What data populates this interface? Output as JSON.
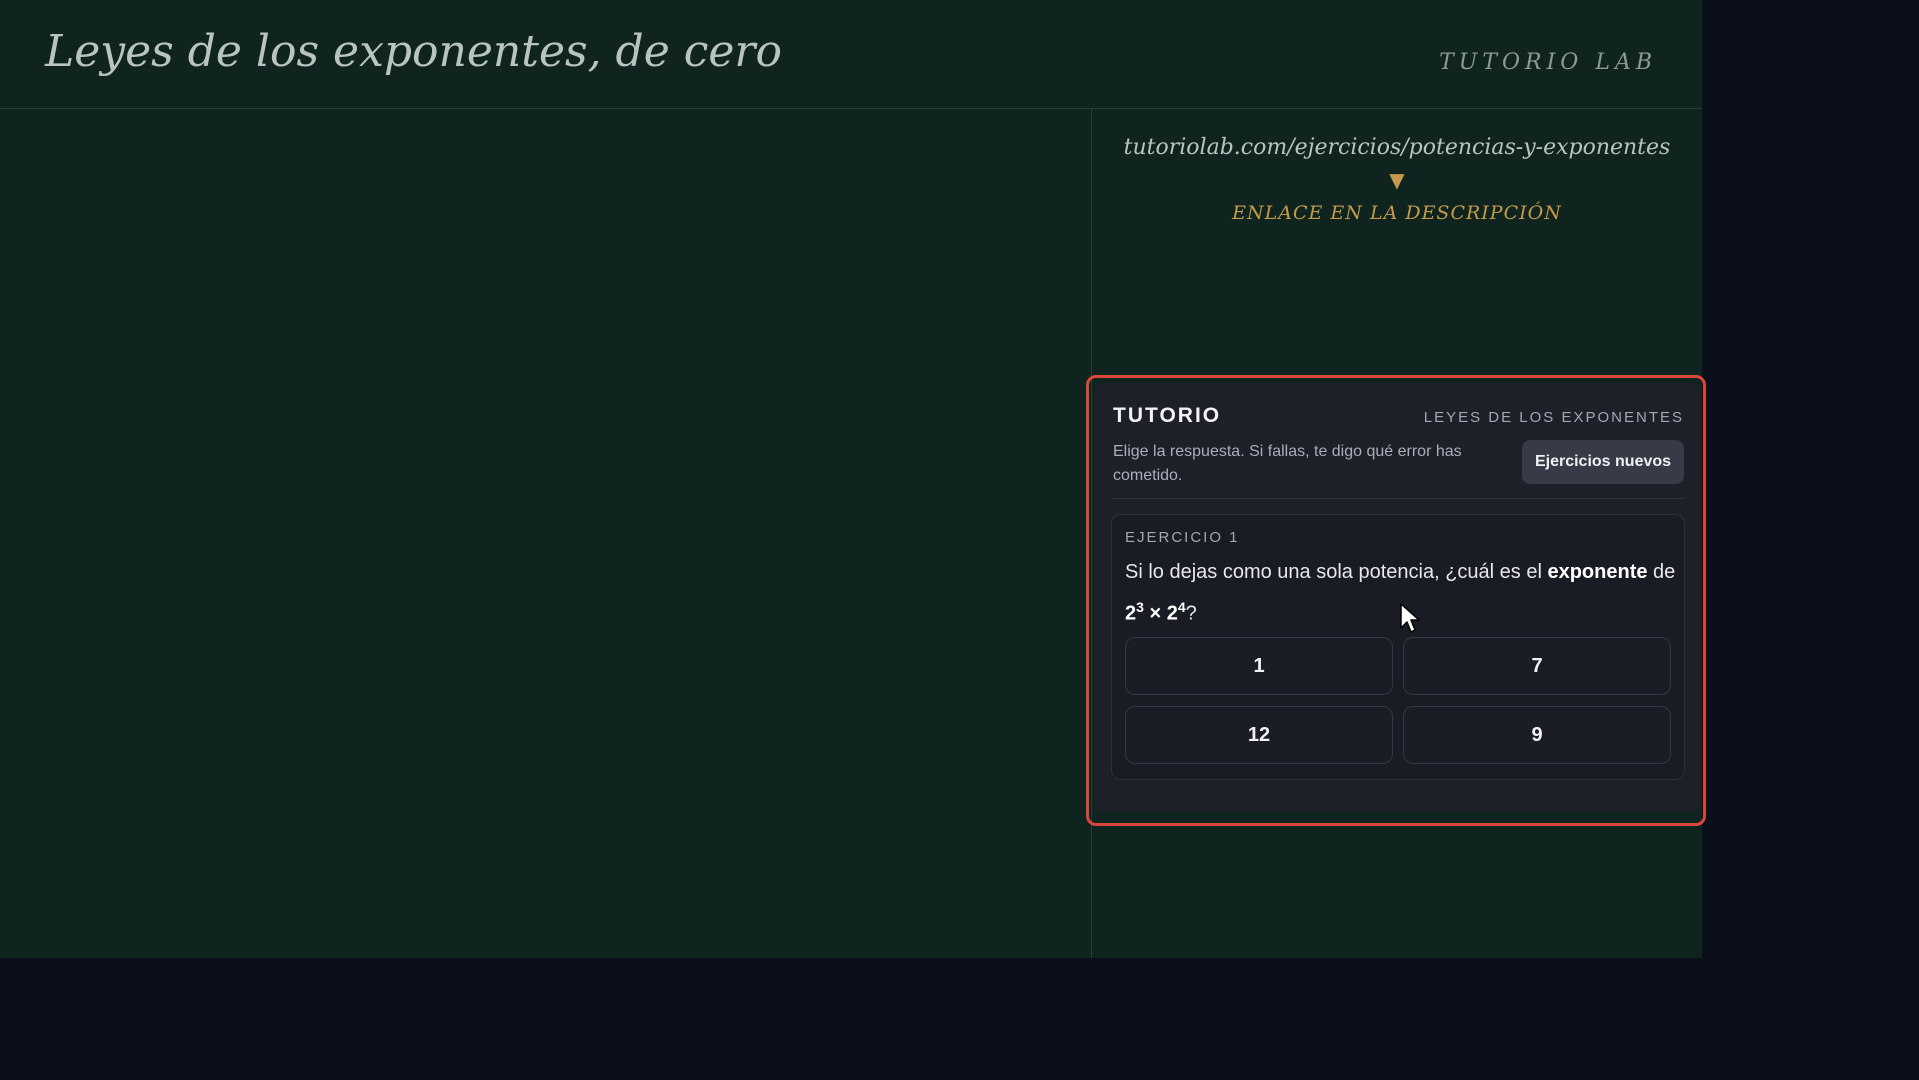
{
  "header": {
    "title": "Leyes de los exponentes, de cero",
    "brand": "TUTORIO LAB"
  },
  "link_area": {
    "url": "tutoriolab.com/ejercicios/potencias-y-exponentes",
    "arrow": "▼",
    "note": "ENLACE EN LA DESCRIPCIÓN"
  },
  "tutorio": {
    "title": "TUTORIO",
    "topic": "LEYES DE LOS EXPONENTES",
    "description": "Elige la respuesta. Si fallas, te digo qué error has cometido.",
    "new_button": "Ejercicios nuevos",
    "exercise": {
      "label": "EJERCICIO 1",
      "question_prefix": "Si lo dejas como una sola potencia, ¿cuál es el ",
      "question_keyword": "exponente",
      "question_mid": " de ",
      "base_1": "2",
      "exp_1": "3",
      "operator": " × ",
      "base_2": "2",
      "exp_2": "4",
      "question_suffix": "?",
      "options": [
        "1",
        "7",
        "12",
        "9"
      ]
    }
  },
  "colors": {
    "stage_bg": "#0f241f",
    "page_bg": "#0b0f1a",
    "panel_bg": "#1d2029",
    "accent_gold": "#c49a4a",
    "highlight_red": "#d9483b"
  }
}
